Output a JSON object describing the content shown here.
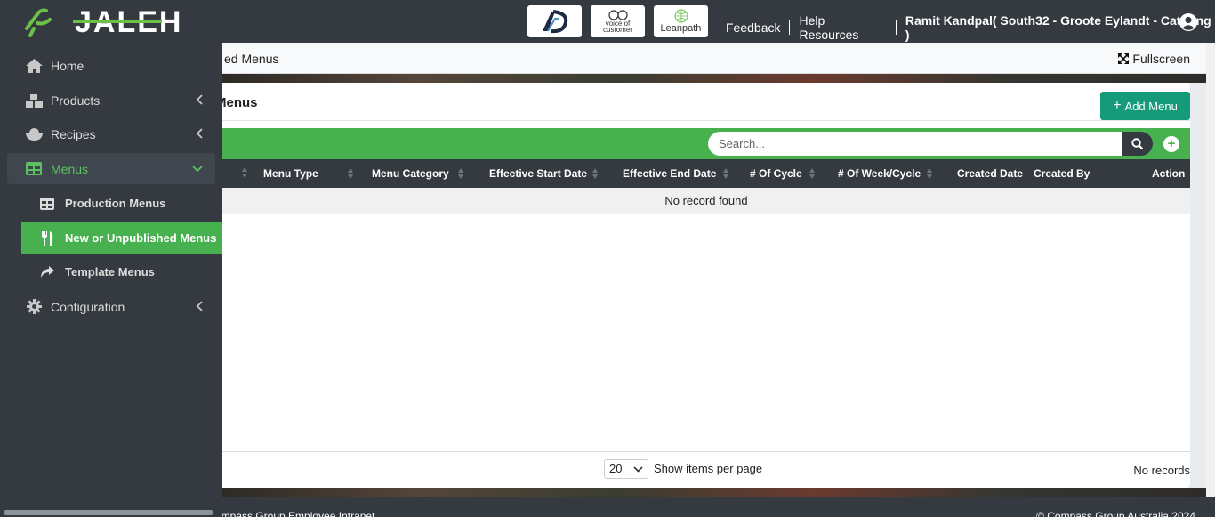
{
  "header": {
    "brand": "JALEH",
    "partners": [
      {
        "name": "ad-logo",
        "label": "AD"
      },
      {
        "name": "voice-of-customer-logo",
        "line1": "voice of",
        "line2": "customer"
      },
      {
        "name": "leanpath-logo",
        "label": "Leanpath"
      }
    ],
    "links": {
      "feedback": "Feedback",
      "help": "Help Resources",
      "user": "Ramit Kandpal( South32 - Groote Eylandt - Catering )"
    }
  },
  "sidebar": {
    "items": [
      {
        "label": "Home",
        "icon": "home-icon"
      },
      {
        "label": "Products",
        "icon": "boxes-icon"
      },
      {
        "label": "Recipes",
        "icon": "bowl-icon"
      },
      {
        "label": "Menus",
        "icon": "table-icon"
      },
      {
        "label": "Configuration",
        "icon": "gear-icon"
      }
    ],
    "submenu": [
      {
        "label": "Production Menus",
        "icon": "table-icon"
      },
      {
        "label": "New or Unpublished Menus",
        "icon": "utensils-icon"
      },
      {
        "label": "Template Menus",
        "icon": "share-icon"
      }
    ]
  },
  "breadcrumb": {
    "text": "ed Menus"
  },
  "fullscreen_label": "Fullscreen",
  "card": {
    "title": "Menus",
    "add_button": "Add Menu",
    "search_placeholder": "Search...",
    "columns": [
      {
        "label": "",
        "sortable": true
      },
      {
        "label": "Menu Type",
        "sortable": true
      },
      {
        "label": "Menu Category",
        "sortable": true
      },
      {
        "label": "Effective Start Date",
        "sortable": true
      },
      {
        "label": "Effective End Date",
        "sortable": true
      },
      {
        "label": "# Of Cycle",
        "sortable": true
      },
      {
        "label": "# Of Week/Cycle",
        "sortable": true
      },
      {
        "label": "Created Date",
        "sortable": false
      },
      {
        "label": "Created By",
        "sortable": false
      },
      {
        "label": "Action",
        "sortable": false
      }
    ],
    "empty_message": "No record found",
    "page_size": "20",
    "page_size_label": "Show items per page",
    "records_status": "No records"
  },
  "footer": {
    "left": "ompass Group Employee Intranet",
    "right": "© Compass Group Australia 2024"
  },
  "colors": {
    "accent_green": "#47b14f",
    "teal_button": "#159a7a",
    "dark": "#343a40"
  }
}
